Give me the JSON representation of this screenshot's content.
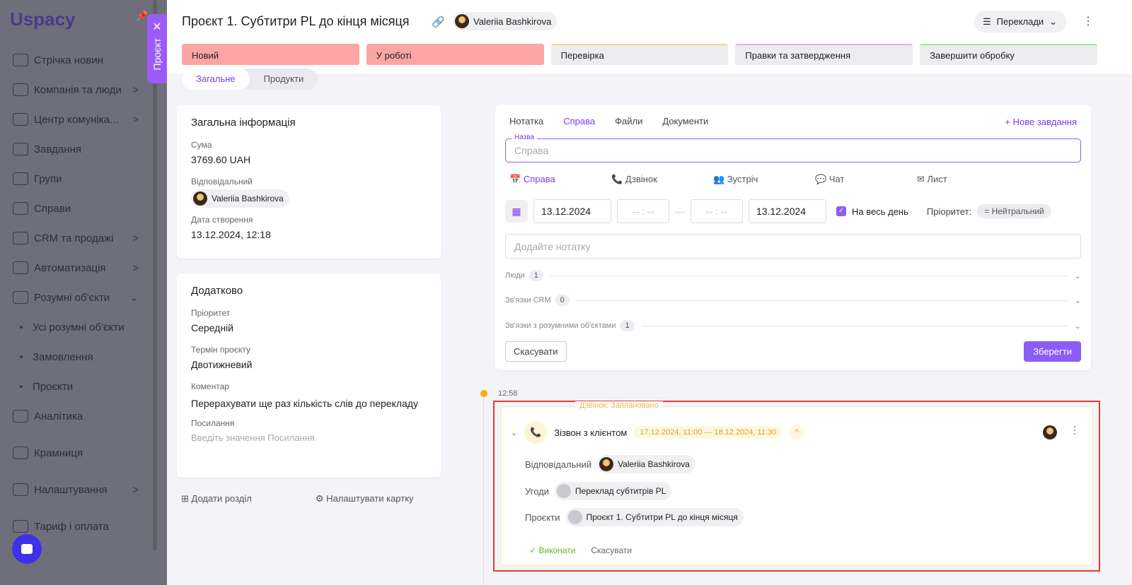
{
  "sidebar": {
    "logo": "Uspacy",
    "items": [
      {
        "label": "Стрічка новин",
        "icon": "home-icon"
      },
      {
        "label": "Компанія та люди",
        "icon": "building-icon",
        "chevron": ">"
      },
      {
        "label": "Центр комуніка...",
        "icon": "chat-icon",
        "chevron": ">"
      },
      {
        "label": "Завдання",
        "icon": "check-circle-icon"
      },
      {
        "label": "Групи",
        "icon": "users-icon"
      },
      {
        "label": "Справи",
        "icon": "calendar-icon"
      },
      {
        "label": "CRM та продажі",
        "icon": "database-icon",
        "chevron": ">"
      },
      {
        "label": "Автоматизація",
        "icon": "bolt-icon",
        "chevron": ">"
      },
      {
        "label": "Розумні об'єкти",
        "icon": "smart-object-icon",
        "chevron": "⌄"
      },
      {
        "label": "Усі розумні об'єкти",
        "sub": true
      },
      {
        "label": "Замовлення",
        "sub": true
      },
      {
        "label": "Проєкти",
        "sub": true
      },
      {
        "label": "Аналітика",
        "icon": "chart-icon"
      },
      {
        "label": "Крамниця",
        "icon": "store-icon"
      },
      {
        "label": "Налаштування",
        "icon": "gear-icon",
        "chevron": ">"
      },
      {
        "label": "Тариф і оплата",
        "icon": "wallet-icon"
      }
    ]
  },
  "panel_tab": {
    "label": "Проєкт",
    "close": "✕"
  },
  "header": {
    "title": "Проєкт 1. Субтитри PL до кінця місяця",
    "user": "Valeriia Bashkirova",
    "category": "Переклади"
  },
  "stages": [
    {
      "label": "Новий",
      "active": true,
      "color": "#fca5a5"
    },
    {
      "label": "У роботі",
      "active": true,
      "color": "#fca5a5"
    },
    {
      "label": "Перевірка",
      "color": "#f5d98a"
    },
    {
      "label": "Правки та затвердження",
      "color": "#f0a8e0"
    },
    {
      "label": "Завершити обробку",
      "color": "#a8e6a0"
    }
  ],
  "tabs": [
    "Загальне",
    "Продукти"
  ],
  "general": {
    "title": "Загальна інформація",
    "sum_label": "Сума",
    "sum": "3769.60 UAH",
    "resp_label": "Відповідальний",
    "resp": "Valeriia Bashkirova",
    "created_label": "Дата створення",
    "created": "13.12.2024, 12:18"
  },
  "extra": {
    "title": "Додатково",
    "prio_label": "Пріоритет",
    "prio": "Середній",
    "term_label": "Термін проєкту",
    "term": "Двотижневий",
    "comment_label": "Коментар",
    "comment": "Перерахувати ще раз кількість слів до перекладу",
    "link_label": "Посилання",
    "link_placeholder": "Введіть значення Посилання"
  },
  "left_actions": {
    "add": "Додати розділ",
    "config": "Налаштувати картку"
  },
  "activity": {
    "tabs": [
      "Нотатка",
      "Справа",
      "Файли",
      "Документи"
    ],
    "new_task": "+ Нове завдання",
    "name_label": "Назва",
    "name_placeholder": "Справа",
    "types": [
      "Справа",
      "Дзвінок",
      "Зустріч",
      "Чат",
      "Лист"
    ],
    "date_from": "13.12.2024",
    "time_from": "-- : --",
    "time_to": "-- : --",
    "date_to": "13.12.2024",
    "all_day": "На весь день",
    "priority_label": "Пріоритет:",
    "priority": "= Нейтральний",
    "note_placeholder": "Додайте нотатку",
    "sections": [
      {
        "label": "Люди",
        "count": "1"
      },
      {
        "label": "Зв'язки CRM",
        "count": "0"
      },
      {
        "label": "Зв'язки з розумними об'єктами",
        "count": "1"
      }
    ],
    "cancel": "Скасувати",
    "save": "Зберегти"
  },
  "timeline": {
    "time": "12:58",
    "call": {
      "status": "Дзвінок: Заплановано",
      "title": "Зізвон з клієнтом",
      "range": "17.12.2024, 11:00 — 18.12.2024, 11:30",
      "resp_label": "Відповідальний",
      "resp": "Valeriia Bashkirova",
      "deals_label": "Угоди",
      "deal": "Переклад субтитрів PL",
      "proj_label": "Проєкти",
      "proj": "Проєкт 1. Субтитри PL до кінця місяця",
      "done": "✓ Виконати",
      "cancel": "Скасувати"
    }
  },
  "colors": {
    "accent": "#8b5cf6",
    "highlight": "#e53935",
    "call": "#e0a21a"
  }
}
